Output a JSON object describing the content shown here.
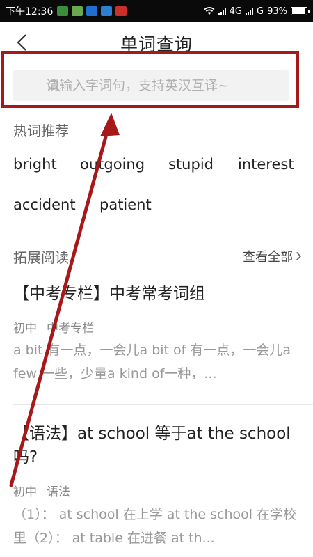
{
  "status_bar": {
    "time": "下午12:36",
    "network_1": "4G",
    "network_2": "G",
    "battery": "93%",
    "battery_level": 0.93
  },
  "header": {
    "title": "单词查询",
    "back_icon": "chevron-left-icon"
  },
  "search": {
    "placeholder": "请输入字词句，支持英汉互译~",
    "value": "",
    "icon": "search-icon"
  },
  "hot_words": {
    "label": "热词推荐",
    "items": [
      "bright",
      "outgoing",
      "stupid",
      "interest",
      "accident",
      "patient"
    ]
  },
  "extended_reading": {
    "label": "拓展阅读",
    "more_label": "查看全部"
  },
  "articles": [
    {
      "title": "【中考专栏】中考常考词组",
      "tags": [
        "初中",
        "中考专栏"
      ],
      "desc": "a bit 有一点，一会儿a bit of 有一点，一会儿a few 一些，少量a kind of一种，..."
    },
    {
      "title": "【语法】at school 等于at the school 吗?",
      "tags": [
        "初中",
        "语法"
      ],
      "desc": "（1）： at school 在上学 at the school 在学校里（2）： at table 在进餐 at th..."
    }
  ],
  "colors": {
    "annotation_red": "#a7181b",
    "background": "#ffffff",
    "status_bar": "#0a0a0a"
  }
}
